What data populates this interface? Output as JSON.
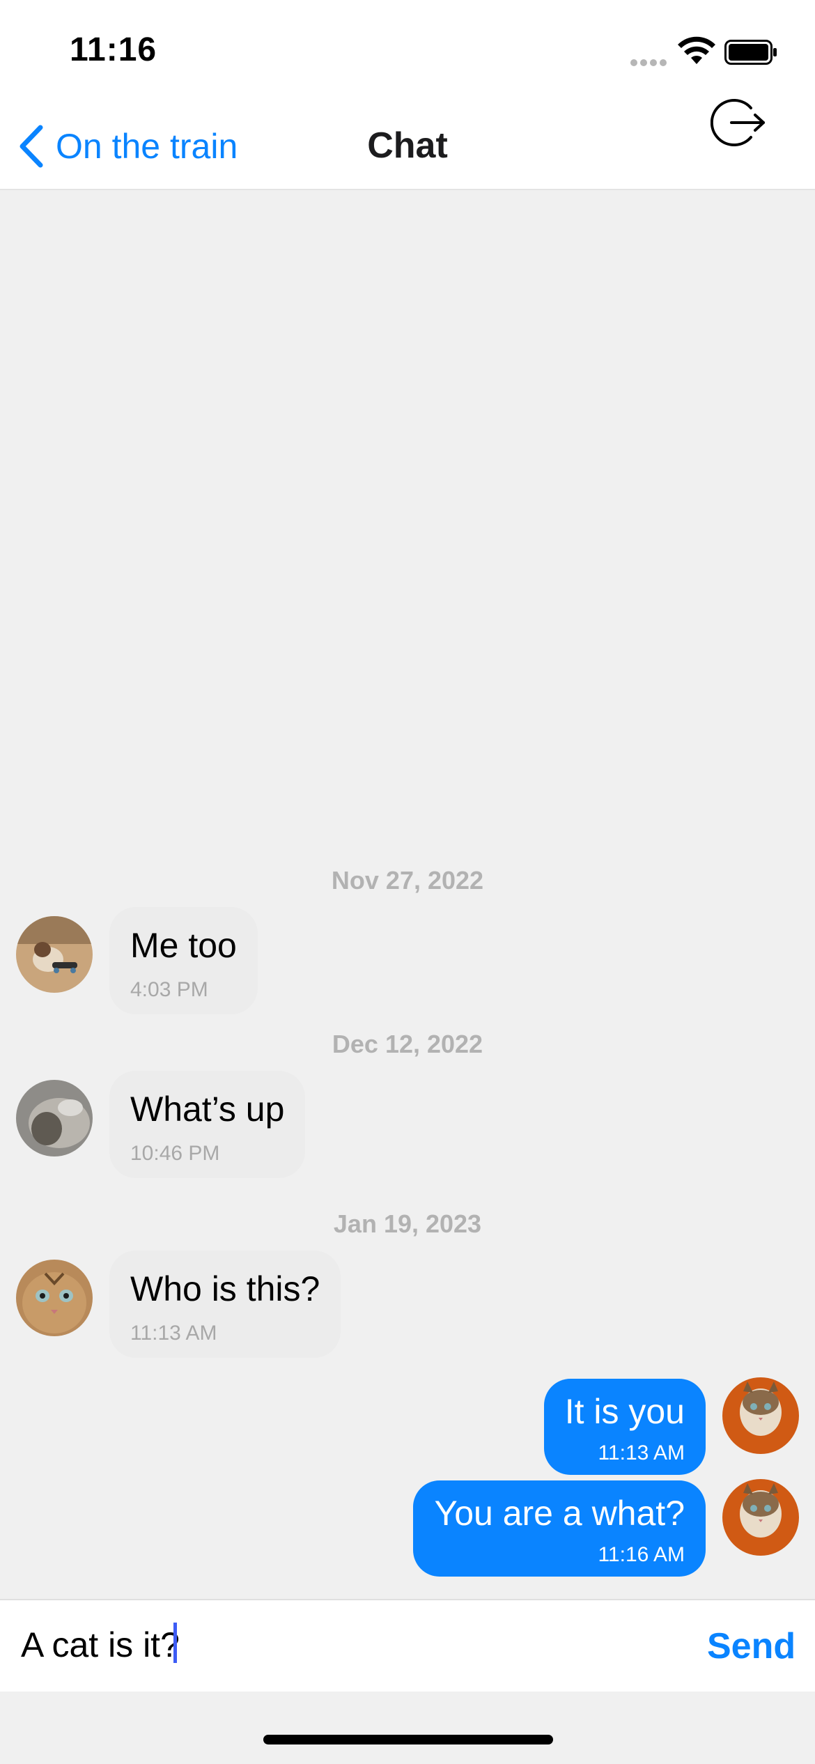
{
  "status_bar": {
    "time": "11:16",
    "icons": [
      "cellular-signal-icon",
      "wifi-icon",
      "battery-icon"
    ]
  },
  "nav": {
    "back_label": "On the train",
    "title": "Chat",
    "back_icon": "chevron-left-icon",
    "action_icon": "logout-icon"
  },
  "colors": {
    "accent": "#0a84ff",
    "incoming_bubble": "#ececec",
    "outgoing_bubble": "#0a84ff",
    "chat_background": "#f0f0f0"
  },
  "messages": [
    {
      "date": "Nov 27, 2022",
      "direction": "incoming",
      "avatar": "dog-skateboard-avatar",
      "text": "Me too",
      "time": "4:03 PM"
    },
    {
      "date": "Dec 12, 2022",
      "direction": "incoming",
      "avatar": "gray-cat-avatar",
      "text": "What’s up",
      "time": "10:46 PM"
    },
    {
      "date": "Jan 19, 2023",
      "direction": "incoming",
      "avatar": "tabby-cat-avatar",
      "text": "Who is this?",
      "time": "11:13 AM"
    },
    {
      "direction": "outgoing",
      "avatar": "tabby-cat-orange-avatar",
      "text": "It is you",
      "time": "11:13 AM"
    },
    {
      "direction": "outgoing",
      "avatar": "tabby-cat-orange-avatar",
      "text": "You are a what?",
      "time": "11:16 AM"
    }
  ],
  "composer": {
    "value": "A cat is it?",
    "send_label": "Send"
  }
}
